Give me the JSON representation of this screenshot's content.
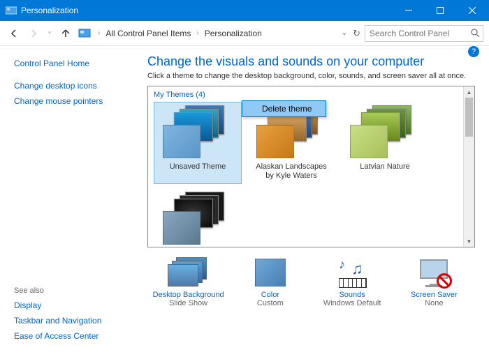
{
  "window": {
    "title": "Personalization"
  },
  "nav": {
    "crumb1": "All Control Panel Items",
    "crumb2": "Personalization",
    "search_placeholder": "Search Control Panel"
  },
  "sidebar": {
    "home": "Control Panel Home",
    "link1": "Change desktop icons",
    "link2": "Change mouse pointers",
    "seealso_title": "See also",
    "seealso1": "Display",
    "seealso2": "Taskbar and Navigation",
    "seealso3": "Ease of Access Center"
  },
  "main": {
    "heading": "Change the visuals and sounds on your computer",
    "subtitle": "Click a theme to change the desktop background, color, sounds, and screen saver all at once.",
    "section_label": "My Themes (4)",
    "themes": [
      {
        "name": "Unsaved Theme"
      },
      {
        "name": "Alaskan Landscapes by Kyle Waters"
      },
      {
        "name": "Latvian Nature"
      }
    ],
    "context_menu": "Delete theme"
  },
  "settings": {
    "bg": {
      "label": "Desktop Background",
      "value": "Slide Show"
    },
    "color": {
      "label": "Color",
      "value": "Custom"
    },
    "sounds": {
      "label": "Sounds",
      "value": "Windows Default"
    },
    "saver": {
      "label": "Screen Saver",
      "value": "None"
    }
  }
}
